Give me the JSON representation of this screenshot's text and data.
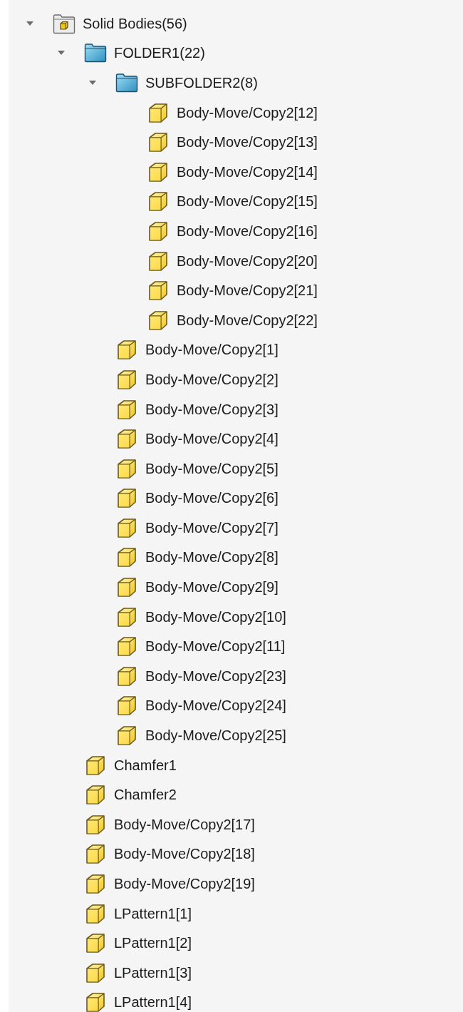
{
  "tree": [
    {
      "kind": "bodies-folder",
      "label": "Solid Bodies(56)",
      "expanded": true,
      "children": [
        {
          "kind": "folder",
          "label": "FOLDER1(22)",
          "expanded": true,
          "children": [
            {
              "kind": "folder",
              "label": "SUBFOLDER2(8)",
              "expanded": true,
              "children": [
                {
                  "kind": "body",
                  "label": "Body-Move/Copy2[12]"
                },
                {
                  "kind": "body",
                  "label": "Body-Move/Copy2[13]"
                },
                {
                  "kind": "body",
                  "label": "Body-Move/Copy2[14]"
                },
                {
                  "kind": "body",
                  "label": "Body-Move/Copy2[15]"
                },
                {
                  "kind": "body",
                  "label": "Body-Move/Copy2[16]"
                },
                {
                  "kind": "body",
                  "label": "Body-Move/Copy2[20]"
                },
                {
                  "kind": "body",
                  "label": "Body-Move/Copy2[21]"
                },
                {
                  "kind": "body",
                  "label": "Body-Move/Copy2[22]"
                }
              ]
            },
            {
              "kind": "body",
              "label": "Body-Move/Copy2[1]"
            },
            {
              "kind": "body",
              "label": "Body-Move/Copy2[2]"
            },
            {
              "kind": "body",
              "label": "Body-Move/Copy2[3]"
            },
            {
              "kind": "body",
              "label": "Body-Move/Copy2[4]"
            },
            {
              "kind": "body",
              "label": "Body-Move/Copy2[5]"
            },
            {
              "kind": "body",
              "label": "Body-Move/Copy2[6]"
            },
            {
              "kind": "body",
              "label": "Body-Move/Copy2[7]"
            },
            {
              "kind": "body",
              "label": "Body-Move/Copy2[8]"
            },
            {
              "kind": "body",
              "label": "Body-Move/Copy2[9]"
            },
            {
              "kind": "body",
              "label": "Body-Move/Copy2[10]"
            },
            {
              "kind": "body",
              "label": "Body-Move/Copy2[11]"
            },
            {
              "kind": "body",
              "label": "Body-Move/Copy2[23]"
            },
            {
              "kind": "body",
              "label": "Body-Move/Copy2[24]"
            },
            {
              "kind": "body",
              "label": "Body-Move/Copy2[25]"
            }
          ]
        },
        {
          "kind": "body",
          "label": "Chamfer1"
        },
        {
          "kind": "body",
          "label": "Chamfer2"
        },
        {
          "kind": "body",
          "label": "Body-Move/Copy2[17]"
        },
        {
          "kind": "body",
          "label": "Body-Move/Copy2[18]"
        },
        {
          "kind": "body",
          "label": "Body-Move/Copy2[19]"
        },
        {
          "kind": "body",
          "label": "LPattern1[1]"
        },
        {
          "kind": "body",
          "label": "LPattern1[2]"
        },
        {
          "kind": "body",
          "label": "LPattern1[3]"
        },
        {
          "kind": "body",
          "label": "LPattern1[4]"
        }
      ]
    }
  ]
}
